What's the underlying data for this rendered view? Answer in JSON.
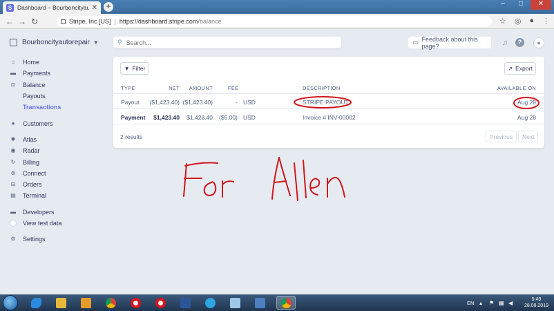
{
  "browser": {
    "tab_title": "Dashboard – Bourboncityautorepair",
    "tab_favicon": "S",
    "url_org": "Stripe, Inc [US]",
    "url_host": "https://dashboard.stripe.com",
    "url_path": "/balance"
  },
  "header": {
    "account_name": "Bourboncityautorepair",
    "search_placeholder": "Search...",
    "feedback_label": "Feedback about this page?"
  },
  "sidebar": {
    "items": [
      {
        "label": "Home",
        "icon": "home-icon"
      },
      {
        "label": "Payments",
        "icon": "payments-icon"
      },
      {
        "label": "Balance",
        "icon": "balance-icon"
      },
      {
        "label": "Payouts",
        "icon": ""
      },
      {
        "label": "Transactions",
        "icon": ""
      },
      {
        "label": "Customers",
        "icon": "customers-icon"
      },
      {
        "label": "Atlas",
        "icon": "atlas-icon"
      },
      {
        "label": "Radar",
        "icon": "radar-icon"
      },
      {
        "label": "Billing",
        "icon": "billing-icon"
      },
      {
        "label": "Connect",
        "icon": "connect-icon"
      },
      {
        "label": "Orders",
        "icon": "orders-icon"
      },
      {
        "label": "Terminal",
        "icon": "terminal-icon"
      },
      {
        "label": "Developers",
        "icon": "developers-icon"
      },
      {
        "label": "View test data",
        "icon": "toggle"
      },
      {
        "label": "Settings",
        "icon": "settings-icon"
      }
    ]
  },
  "toolbar": {
    "filter_label": "Filter",
    "export_label": "Export"
  },
  "table": {
    "columns": [
      "TYPE",
      "NET",
      "AMOUNT",
      "FEE",
      "DESCRIPTION",
      "AVAILABLE ON"
    ],
    "rows": [
      {
        "type": "Payout",
        "net": "($1,423.40)",
        "amount": "($1,423.40)",
        "fee": "-",
        "currency": "USD",
        "description": "STRIPE PAYOUT",
        "available_on": "Aug 28"
      },
      {
        "type": "Payment",
        "net": "$1,423.40",
        "amount": "$1,428.40",
        "fee": "($5.00)",
        "currency": "USD",
        "description": "Invoice # INV-00002",
        "available_on": "Aug 28"
      }
    ],
    "results_label": "2 results",
    "previous_label": "Previous",
    "next_label": "Next"
  },
  "annotation": {
    "handwritten_text": "For Allen",
    "color": "#d0161b"
  },
  "taskbar": {
    "language": "EN",
    "time": "5:49",
    "date": "28.08.2019"
  },
  "colors": {
    "accent": "#6772e5",
    "background": "#e6ebf1"
  }
}
